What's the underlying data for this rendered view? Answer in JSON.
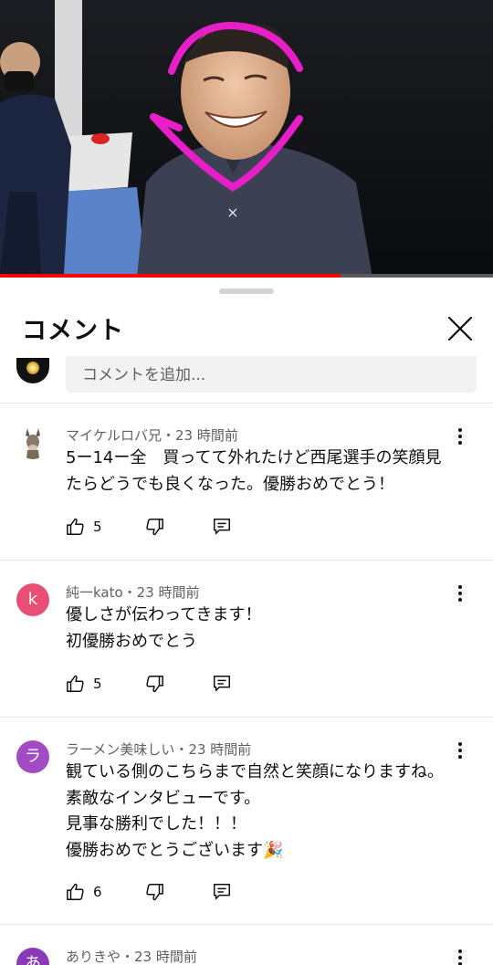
{
  "player": {
    "progress_fraction": 0.69
  },
  "sheet": {
    "title": "コメント",
    "placeholder": "コメントを追加..."
  },
  "comments": [
    {
      "author": "マイケルロバ兄",
      "time": "23 時間前",
      "meta": "マイケルロバ兄・23 時間前",
      "lines": [
        "5ー14ー全　買ってて外れたけど西尾選手の笑顔見",
        "たらどうでも良くなった。優勝おめでとう！"
      ],
      "likes": "5",
      "avatar_icon": "donkey-avatar"
    },
    {
      "author": "純一kato",
      "time": "23 時間前",
      "meta": "純一kato・23 時間前",
      "lines": [
        "優しさが伝わってきます！",
        "初優勝おめでとう"
      ],
      "likes": "5",
      "avatar_letter": "k",
      "avatar_color": "#e94e77"
    },
    {
      "author": "ラーメン美味しい",
      "time": "23 時間前",
      "meta": "ラーメン美味しい・23 時間前",
      "lines": [
        "観ている側のこちらまで自然と笑顔になりますね。",
        "素敵なインタビューです。",
        "見事な勝利でした！！！",
        "優勝おめでとうございます🎉"
      ],
      "likes": "6",
      "avatar_letter": "ラ",
      "avatar_color": "#a24bc4"
    },
    {
      "author": "ありきや",
      "time": "23 時間前",
      "meta": "ありきや・23 時間前",
      "avatar_letter": "あ",
      "avatar_color": "#8a3ab9"
    }
  ],
  "icons": {
    "close": "close-icon",
    "more": "more-vertical-icon",
    "like": "thumbs-up-icon",
    "dislike": "thumbs-down-icon",
    "reply": "reply-icon"
  },
  "colors": {
    "progress": "#ff0000",
    "annotation": "#e81fc8"
  }
}
